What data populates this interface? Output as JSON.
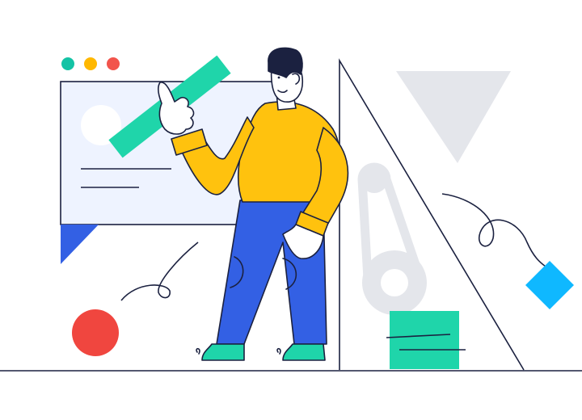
{
  "illustration": {
    "subject": "man-pointing-at-board",
    "colors": {
      "navy": "#1b2140",
      "yellow": "#ffc20e",
      "blue": "#3360e4",
      "mint": "#1fd5aa",
      "red": "#f0463f",
      "teal": "#13c3a5",
      "orange": "#ffb800",
      "coral": "#f2544c",
      "sky": "#0fb8ff",
      "board": "#eef3ff",
      "gray": "#e4e6eb",
      "skin": "#ffffff"
    },
    "icons": [
      "window-dots",
      "ruler",
      "triangle-ruler",
      "gear-belt",
      "diamond",
      "circle"
    ]
  }
}
